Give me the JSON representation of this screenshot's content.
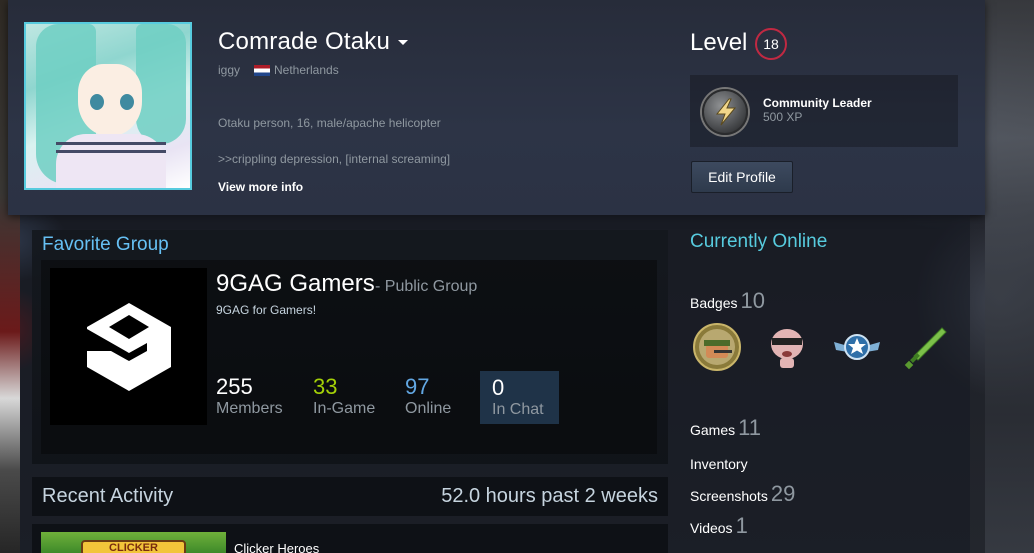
{
  "profile": {
    "persona_name": "Comrade Otaku",
    "real_name": "iggy",
    "country": "Netherlands",
    "summary_line1": "Otaku person, 16, male/apache helicopter",
    "summary_line2": ">>crippling depression, [internal screaming]",
    "view_more": "View more info",
    "level_label": "Level",
    "level_value": "18",
    "featured_badge": {
      "title": "Community Leader",
      "xp": "500 XP"
    },
    "edit_button": "Edit Profile",
    "colors": {
      "accent_blue": "#66c0f4",
      "online": "#57cbde",
      "level_ring": "#c02942",
      "in_game": "#a4d007",
      "online_count": "#62a7e3"
    }
  },
  "favorite_group": {
    "header": "Favorite Group",
    "name": "9GAG Gamers",
    "type": "- Public Group",
    "description": "9GAG for Gamers!",
    "stats": {
      "members": {
        "value": "255",
        "label": "Members"
      },
      "in_game": {
        "value": "33",
        "label": "In-Game"
      },
      "online": {
        "value": "97",
        "label": "Online"
      },
      "in_chat": {
        "value": "0",
        "label": "In Chat"
      }
    }
  },
  "recent_activity": {
    "title": "Recent Activity",
    "hours": "52.0 hours past 2 weeks",
    "games": [
      {
        "name": "Clicker Heroes",
        "banner": "CLICKER"
      }
    ]
  },
  "sidebar": {
    "status": "Currently Online",
    "badges": {
      "label": "Badges",
      "count": "10",
      "icons": [
        "soldier-badge-icon",
        "isaac-badge-icon",
        "star-wings-badge-icon",
        "sword-badge-icon"
      ]
    },
    "games": {
      "label": "Games",
      "count": "11"
    },
    "inventory": {
      "label": "Inventory"
    },
    "screenshots": {
      "label": "Screenshots",
      "count": "29"
    },
    "videos": {
      "label": "Videos",
      "count": "1"
    }
  }
}
